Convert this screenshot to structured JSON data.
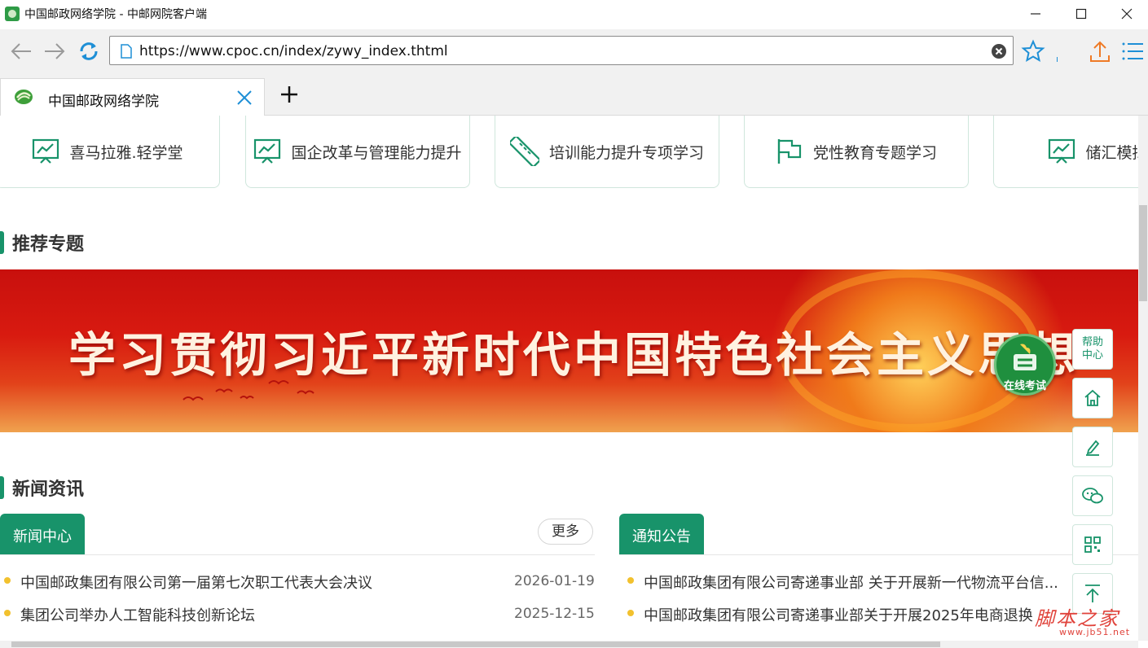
{
  "window": {
    "title": "中国邮政网络学院 - 中邮网院客户端"
  },
  "address_bar": {
    "url": "https://www.cpoc.cn/index/zywy_index.thtml"
  },
  "tabs": [
    {
      "label": "中国邮政网络学院"
    }
  ],
  "colors": {
    "brand_green": "#18936a",
    "dot_yellow": "#f2c12e",
    "banner_red": "#d81a10"
  },
  "quick_cards": [
    {
      "label": "喜马拉雅.轻学堂",
      "icon": "presentation-chart-icon"
    },
    {
      "label": "国企改革与管理能力提升",
      "icon": "presentation-chart-icon"
    },
    {
      "label": "培训能力提升专项学习",
      "icon": "ruler-icon"
    },
    {
      "label": "党性教育专题学习",
      "icon": "flag-icon"
    },
    {
      "label": "储汇模拟实",
      "icon": "presentation-chart-icon"
    }
  ],
  "sections": {
    "recommended": "推荐专题",
    "news": "新闻资讯"
  },
  "banner": {
    "text": "学习贯彻习近平新时代中国特色社会主义思想"
  },
  "floating": {
    "exam_label": "在线考试",
    "help_label": "帮助中心",
    "buttons": [
      "home-icon",
      "edit-icon",
      "wechat-icon",
      "qrcode-icon",
      "back-to-top-icon"
    ]
  },
  "news": {
    "left_tab": "新闻中心",
    "more_label": "更多",
    "left_items": [
      {
        "title": "中国邮政集团有限公司第一届第七次职工代表大会决议",
        "date": "2026-01-19"
      },
      {
        "title": "集团公司举办人工智能科技创新论坛",
        "date": "2025-12-15"
      }
    ],
    "right_tab": "通知公告",
    "right_items": [
      {
        "title": "中国邮政集团有限公司寄递事业部 关于开展新一代物流平台信..."
      },
      {
        "title": "中国邮政集团有限公司寄递事业部关于开展2025年电商退换"
      }
    ]
  },
  "watermark": {
    "text": "脚本之家",
    "sub": "www.jb51.net"
  }
}
